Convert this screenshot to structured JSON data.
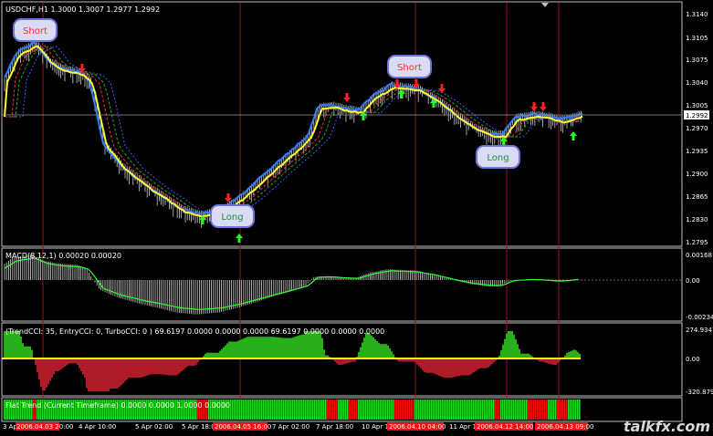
{
  "symbol_header": "USDCHF,H1   1.3000 1.3007 1.2977 1.2992",
  "price_axis": {
    "ticks": [
      "1.3140",
      "1.3105",
      "1.3075",
      "1.3040",
      "1.3005",
      "1.2970",
      "1.2935",
      "1.2900",
      "1.2865",
      "1.2830",
      "1.2795"
    ],
    "current_price": "1.2992"
  },
  "signals": {
    "short_1": "Short",
    "short_2": "Short",
    "long_1": "Long",
    "long_2": "Long"
  },
  "macd": {
    "label": "MACD(8,12,1) 0.00020 0.00020",
    "ticks": [
      "0.00168",
      "0.00",
      "-0.00234"
    ]
  },
  "trend_cci": {
    "label": "(TrendCCI: 35, EntryCCI: 0, TurboCCI: 0 )  69.6197 0.0000 0.0000 0.0000 69.6197 0.0000 0.0000 0.0000",
    "ticks": [
      "274.9347",
      "0.00",
      "-320.879"
    ]
  },
  "flat_trend": {
    "label": "Flat Trend (Current Timeframe) 0.0000 0.0000 1.0000 0.0000"
  },
  "time_axis": {
    "labels": [
      "3 Ap",
      "4 Apr 10:00",
      "5 Apr 02:00",
      "5 Apr 18:00",
      "7 Apr 02:00",
      "7 Apr 18:00",
      "10 Apr 1",
      "11 Apr 1"
    ],
    "highlighted": [
      "2006.04.03 20:00",
      "2006.04.05 16:00",
      "2006.04.10 04:00",
      "2006.04.12 14:00",
      "2006.04.13 09:00"
    ]
  },
  "watermark": "talkfx.com",
  "colors": {
    "background": "#000000",
    "grid_vertical": "#a01010",
    "price_line": "#ffff33",
    "ma_fast": "#2f7fff",
    "ma_red": "#ff2a2a",
    "ma_green": "#1fae1f",
    "ma_blue_dotted": "#3a5cff",
    "bars": "#c8c8c8",
    "arrow_up": "#22ff22",
    "arrow_down": "#ff2222",
    "macd_bars": "#cfcfcf",
    "macd_signal": "#33ff33",
    "cci_pos": "#33dd22",
    "cci_neg": "#dd2233",
    "cci_zero": "#ffff00",
    "flat_green": "#22dd22",
    "flat_red": "#ee1111"
  }
}
